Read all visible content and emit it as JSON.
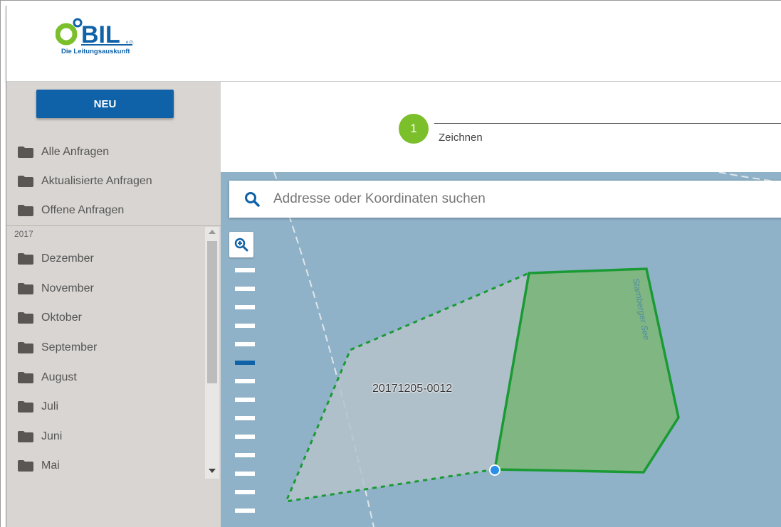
{
  "header": {
    "logo_text": "BIL",
    "logo_sub": "e.G.",
    "logo_tagline": "Die Leitungsauskunft"
  },
  "sidebar": {
    "new_button": "NEU",
    "items": [
      {
        "label": "Alle Anfragen"
      },
      {
        "label": "Aktualisierte Anfragen"
      },
      {
        "label": "Offene Anfragen"
      }
    ],
    "year": "2017",
    "months": [
      {
        "label": "Dezember"
      },
      {
        "label": "November"
      },
      {
        "label": "Oktober"
      },
      {
        "label": "September"
      },
      {
        "label": "August"
      },
      {
        "label": "Juli"
      },
      {
        "label": "Juni"
      },
      {
        "label": "Mai"
      }
    ]
  },
  "stepper": {
    "step_number": "1",
    "step_label": "Zeichnen"
  },
  "map": {
    "search_placeholder": "Addresse oder Koordinaten suchen",
    "polygon_label": "20171205-0012",
    "lake_label": "Starnberger See"
  },
  "colors": {
    "primary": "#0f62a8",
    "step_green": "#7bbf2a",
    "polygon_green": "#1a9a35",
    "map_water": "#8fb2c8"
  }
}
